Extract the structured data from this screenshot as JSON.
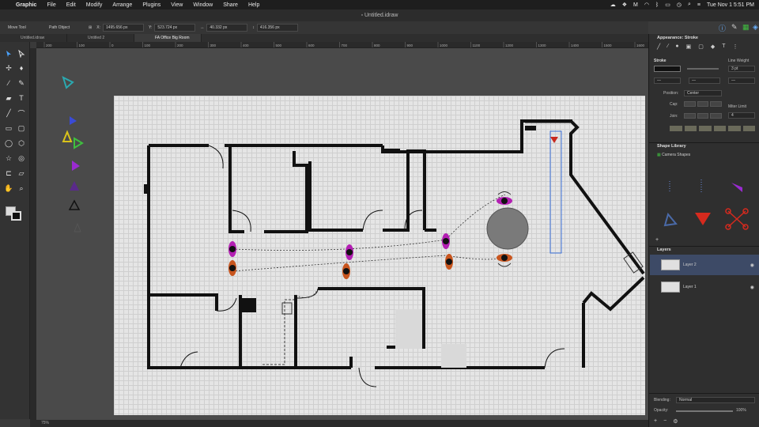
{
  "menubar": {
    "app_name": "Graphic",
    "items": [
      "File",
      "Edit",
      "Modify",
      "Arrange",
      "Plugins",
      "View",
      "Window",
      "Share",
      "Help"
    ],
    "clock": "Tue Nov 1  5:51 PM"
  },
  "window": {
    "title": "Untitled.idraw"
  },
  "toolbar": {
    "tool_name": "Move Tool",
    "selection_type": "Path Object",
    "x_label": "X:",
    "x_value": "1495.656 px",
    "y_label": "Y:",
    "y_value": "523.724 px",
    "w_value": "40.332 px",
    "h_value": "416.356 px"
  },
  "tabs": [
    {
      "label": "Untitled.idraw"
    },
    {
      "label": "Untitled 2"
    },
    {
      "label": "FA Office Big Room"
    }
  ],
  "ruler": {
    "ticks": [
      "200",
      "100",
      "0",
      "100",
      "200",
      "300",
      "400",
      "500",
      "600",
      "700",
      "800",
      "900",
      "1000",
      "1100",
      "1200",
      "1300",
      "1400",
      "1500",
      "1600",
      "1700"
    ]
  },
  "status": {
    "zoom": "75%"
  },
  "appearance": {
    "title": "Appearance: Stroke",
    "stroke_label": "Stroke",
    "line_weight_label": "Line Weight",
    "line_weight_value": "3 pt",
    "position_label": "Position:",
    "position_value": "Center",
    "cap_label": "Cap:",
    "join_label": "Join:",
    "miter_label": "Miter Limit",
    "miter_value": "4"
  },
  "shape_library": {
    "title": "Shape Library",
    "category": "Camera Shapes"
  },
  "layers": {
    "title": "Layers",
    "items": [
      {
        "name": "Layer 2",
        "selected": true
      },
      {
        "name": "Layer 1",
        "selected": false
      }
    ]
  },
  "blending": {
    "blending_label": "Blending:",
    "blending_value": "Normal",
    "opacity_label": "Opacity:",
    "opacity_value": "100%"
  }
}
